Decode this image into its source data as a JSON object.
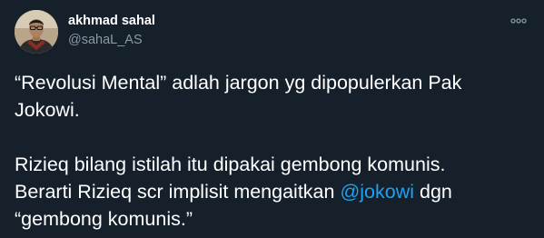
{
  "tweet": {
    "author": {
      "display_name": "akhmad sahal",
      "handle": "@sahaL_AS"
    },
    "more_icon": "more-horizontal-icon",
    "text": {
      "line1": "“Revolusi Mental” adlah jargon yg dipopulerkan Pak",
      "line2": "Jokowi.",
      "line3": "Rizieq bilang istilah itu dipakai gembong komunis.",
      "line4_before": "Berarti Rizieq scr implisit mengaitkan ",
      "line4_mention": "@jokowi",
      "line4_after": " dgn",
      "line5": "“gembong komunis.”"
    }
  },
  "colors": {
    "background": "#15202b",
    "text": "#ffffff",
    "secondary": "#8899a6",
    "link": "#1da1f2"
  }
}
